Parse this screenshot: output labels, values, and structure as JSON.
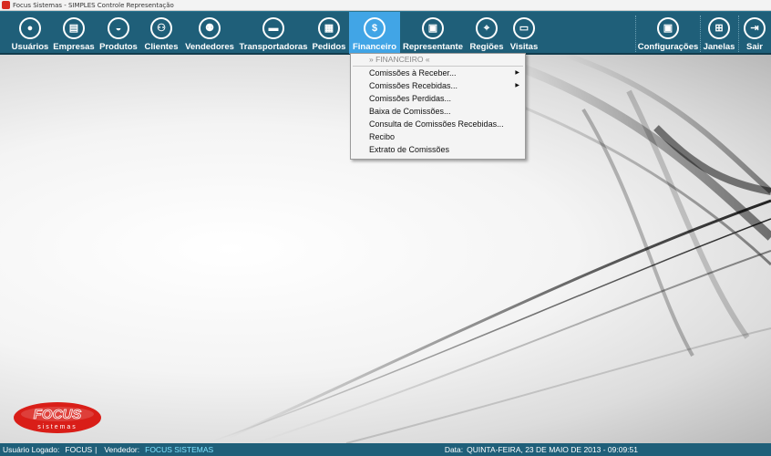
{
  "window": {
    "title": "Focus Sistemas - SIMPLES Controle Representação"
  },
  "toolbar": {
    "left": [
      {
        "id": "usuarios",
        "label": "Usuários",
        "icon": "user-icon",
        "glyph": "●"
      },
      {
        "id": "empresas",
        "label": "Empresas",
        "icon": "building-icon",
        "glyph": "▤"
      },
      {
        "id": "produtos",
        "label": "Produtos",
        "icon": "basket-icon",
        "glyph": "◒"
      },
      {
        "id": "clientes",
        "label": "Clientes",
        "icon": "users-icon",
        "glyph": "⚇"
      },
      {
        "id": "vendedores",
        "label": "Vendedores",
        "icon": "group-icon",
        "glyph": "⚉"
      },
      {
        "id": "transportadoras",
        "label": "Transportadoras",
        "icon": "truck-icon",
        "glyph": "▬"
      },
      {
        "id": "pedidos",
        "label": "Pedidos",
        "icon": "calculator-icon",
        "glyph": "▦"
      },
      {
        "id": "financeiro",
        "label": "Financeiro",
        "icon": "dollar-icon",
        "glyph": "$"
      },
      {
        "id": "representante",
        "label": "Representante",
        "icon": "cash-register-icon",
        "glyph": "▣"
      },
      {
        "id": "regioes",
        "label": "Regiões",
        "icon": "map-pin-icon",
        "glyph": "⌖"
      },
      {
        "id": "visitas",
        "label": "Visitas",
        "icon": "card-icon",
        "glyph": "▭"
      }
    ],
    "right": [
      {
        "id": "configuracoes",
        "label": "Configurações",
        "icon": "floppy-icon",
        "glyph": "▣"
      },
      {
        "id": "janelas",
        "label": "Janelas",
        "icon": "windows-icon",
        "glyph": "⊞"
      },
      {
        "id": "sair",
        "label": "Sair",
        "icon": "exit-icon",
        "glyph": "⇥"
      }
    ],
    "active": "financeiro"
  },
  "menu": {
    "header": "» FINANCEIRO «",
    "items": [
      {
        "label": "Comissões à Receber...",
        "submenu": true
      },
      {
        "label": "Comissões Recebidas...",
        "submenu": true
      },
      {
        "label": "Comissões Perdidas...",
        "submenu": false
      },
      {
        "label": "Baixa de Comissões...",
        "submenu": false
      },
      {
        "label": "Consulta de Comissões Recebidas...",
        "submenu": false
      },
      {
        "label": "Recibo",
        "submenu": false
      },
      {
        "label": "Extrato de Comissões",
        "submenu": false
      }
    ]
  },
  "logo": {
    "text": "FOCUS",
    "subtext": "sistemas",
    "color": "#d91e18"
  },
  "status": {
    "user_label": "Usuário Logado:",
    "user_value": "FOCUS",
    "divider": "|",
    "seller_label": "Vendedor:",
    "seller_value": "FOCUS SISTEMAS",
    "date_label": "Data:",
    "date_value": "QUINTA-FEIRA, 23 DE MAIO DE 2013 - 09:09:51"
  },
  "colors": {
    "toolbar": "#1f5f79",
    "active": "#41a5e6",
    "status_value": "#7fe3ff"
  }
}
